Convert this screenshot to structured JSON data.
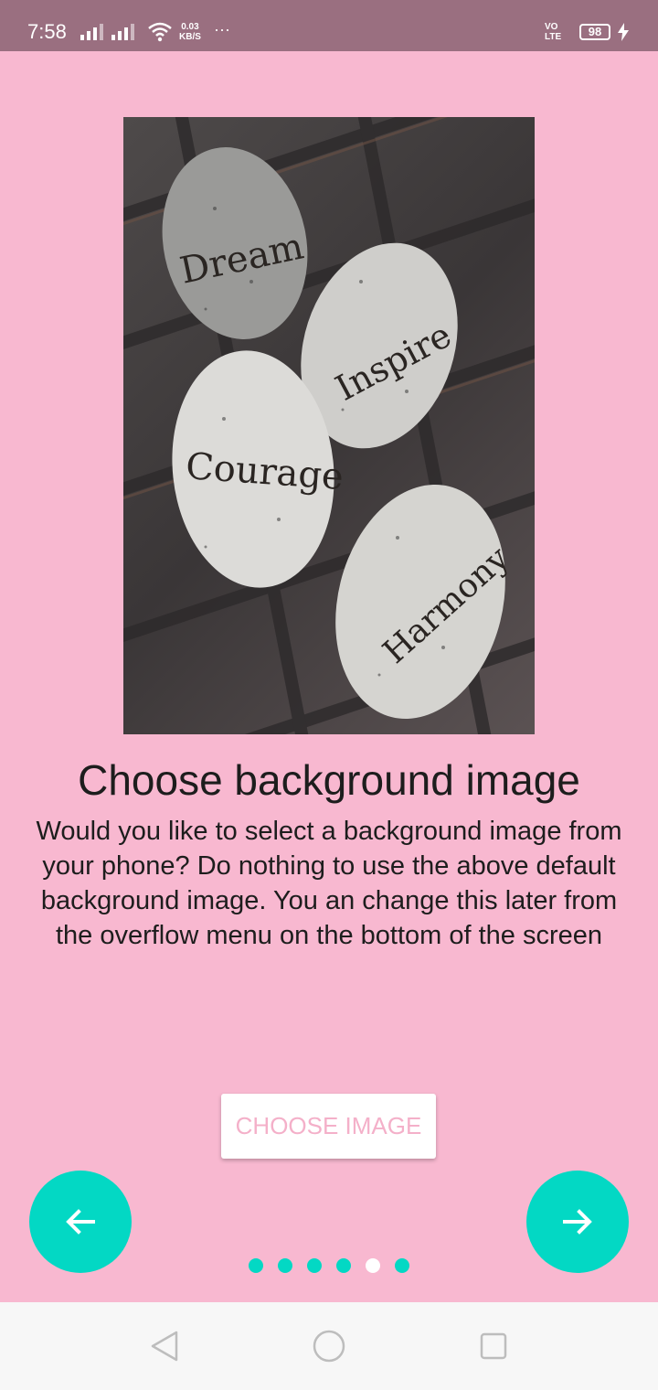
{
  "status_bar": {
    "time": "7:58",
    "net_speed_value": "0.03",
    "net_speed_unit": "KB/S",
    "more_indicator": "···",
    "volte_line1": "VO",
    "volte_line2": "LTE",
    "battery": "98"
  },
  "hero": {
    "stones": [
      "Dream",
      "Inspire",
      "Courage",
      "Harmony"
    ]
  },
  "content": {
    "title": "Choose background image",
    "description": "Would you like to select a background image from your phone? Do nothing to use the above default background image. You an change this later from the overflow menu on the bottom of the screen"
  },
  "actions": {
    "choose_label": "CHOOSE IMAGE"
  },
  "pager": {
    "count": 6,
    "active_index": 4
  },
  "colors": {
    "background": "#f8b8d0",
    "accent": "#03d8c4",
    "button_text": "#f4b0c9"
  },
  "icons": {
    "prev": "arrow-left-icon",
    "next": "arrow-right-icon",
    "back": "back-triangle-icon",
    "home": "home-circle-icon",
    "recents": "recents-square-icon"
  }
}
